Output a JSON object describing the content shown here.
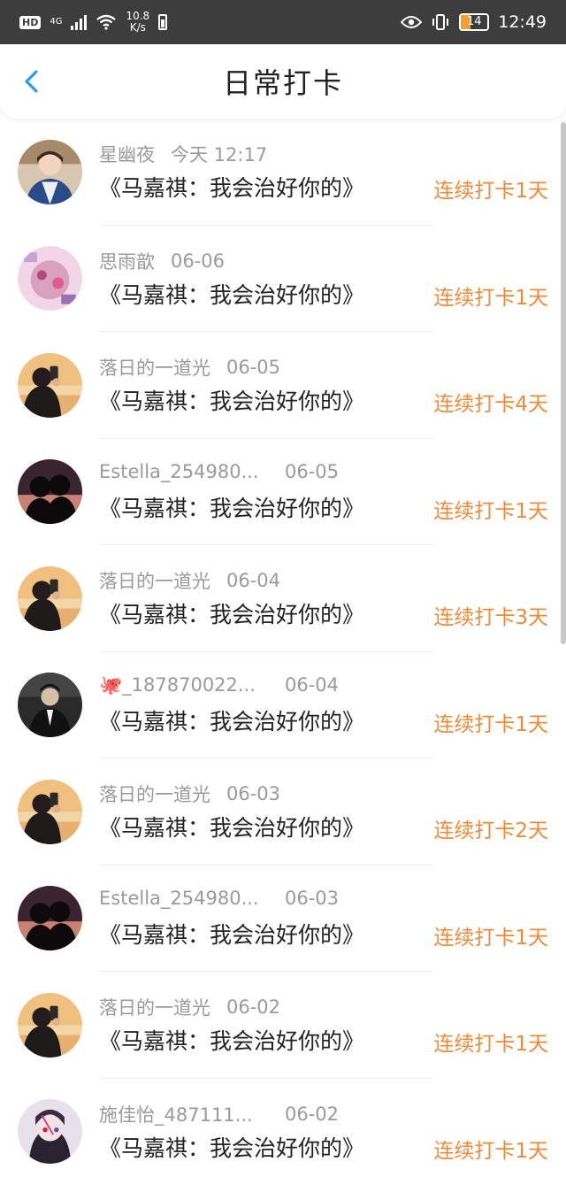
{
  "status_bar": {
    "hd": "HD",
    "network": "4G",
    "speed_value": "10.8",
    "speed_unit": "K/s",
    "battery": "14",
    "time": "12:49"
  },
  "header": {
    "title": "日常打卡",
    "back_icon": "chevron-left-icon"
  },
  "accent_color": "#f08a3a",
  "entries": [
    {
      "name": "星幽夜",
      "date": "今天 12:17",
      "book": "《马嘉祺：我会治好你的》",
      "streak": "连续打卡1天",
      "avatar": "girl-blue-jacket"
    },
    {
      "name": "思雨歆",
      "date": "06-06",
      "book": "《马嘉祺：我会治好你的》",
      "streak": "连续打卡1天",
      "avatar": "pink-anime"
    },
    {
      "name": "落日的一道光",
      "date": "06-05",
      "book": "《马嘉祺：我会治好你的》",
      "streak": "连续打卡4天",
      "avatar": "sunset-phone"
    },
    {
      "name": "Estella_254980...",
      "date": "06-05",
      "book": "《马嘉祺：我会治好你的》",
      "streak": "连续打卡1天",
      "avatar": "silhouette-couple"
    },
    {
      "name": "落日的一道光",
      "date": "06-04",
      "book": "《马嘉祺：我会治好你的》",
      "streak": "连续打卡3天",
      "avatar": "sunset-phone"
    },
    {
      "name": "🐙_187870022...",
      "date": "06-04",
      "book": "《马嘉祺：我会治好你的》",
      "streak": "连续打卡1天",
      "avatar": "man-in-suit"
    },
    {
      "name": "落日的一道光",
      "date": "06-03",
      "book": "《马嘉祺：我会治好你的》",
      "streak": "连续打卡2天",
      "avatar": "sunset-phone"
    },
    {
      "name": "Estella_254980...",
      "date": "06-03",
      "book": "《马嘉祺：我会治好你的》",
      "streak": "连续打卡1天",
      "avatar": "silhouette-couple"
    },
    {
      "name": "落日的一道光",
      "date": "06-02",
      "book": "《马嘉祺：我会治好你的》",
      "streak": "连续打卡1天",
      "avatar": "sunset-phone"
    },
    {
      "name": "施佳怡_487111...",
      "date": "06-02",
      "book": "《马嘉祺：我会治好你的》",
      "streak": "连续打卡1天",
      "avatar": "anime-boy-red-eye"
    }
  ]
}
